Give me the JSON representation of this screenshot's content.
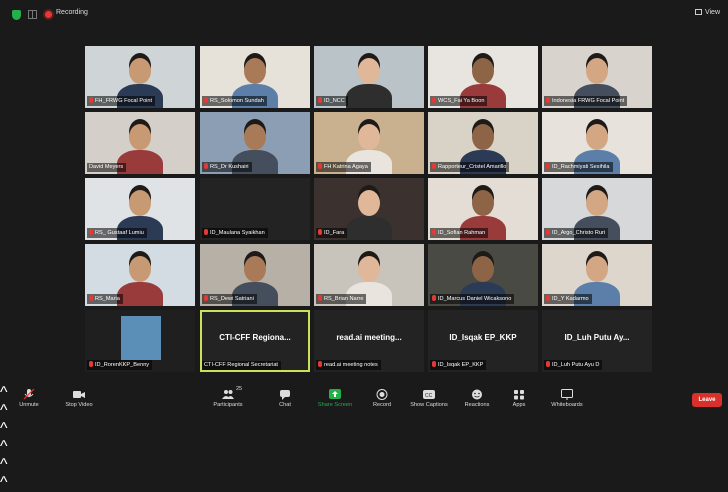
{
  "topbar": {
    "recording_label": "Recording",
    "view_label": "View"
  },
  "tiles": [
    [
      "FH_FRWG Focal Point",
      "RS_Solomon Sundah",
      "ID_NCC",
      "WCS_Fai Ya Boon",
      "Indonesia FRWG Focal Point"
    ],
    [
      "David Meyers",
      "RS_Dr Kushairi",
      "FH Katrina Agaya",
      "Rapporteur_Cristel Amarillo",
      "ID_Rachmiyati Sesihila"
    ],
    [
      "RS_ Gustaaf Lumiu",
      "ID_Maulana Syaikhan",
      "ID_Fara",
      "ID_Sofian Rahman",
      "ID_Argo_Christo Ruri"
    ],
    [
      "RS_Maria",
      "RS_Dewi Satriani",
      "RS_Brian Narre",
      "ID_Marcus Daniel Wicaksono",
      "ID_Y Kadarmo"
    ],
    [
      "ID_RorenKKP_Benny",
      "CTI-CFF Regional Secretariat",
      "read.ai meeting notes",
      "ID_Isqak EP_KKP",
      "ID_Luh Putu Ayu D"
    ]
  ],
  "big_titles": {
    "r4c1": "CTI-CFF Regiona...",
    "r4c2": "read.ai meeting...",
    "r4c3": "ID_Isqak EP_KKP",
    "r4c4": "ID_Luh Putu Ay..."
  },
  "toolbar": {
    "unmute": "Unmute",
    "stop_video": "Stop Video",
    "participants": "Participants",
    "participants_count": "25",
    "chat": "Chat",
    "share_screen": "Share Screen",
    "record": "Record",
    "show_captions": "Show Captions",
    "reactions": "Reactions",
    "apps": "Apps",
    "whiteboards": "Whiteboards",
    "leave": "Leave"
  },
  "colors": {
    "share_green": "#23b04a",
    "leave_red": "#d9302c",
    "active_border": "#c8e35a",
    "muted_red": "#e53935"
  }
}
